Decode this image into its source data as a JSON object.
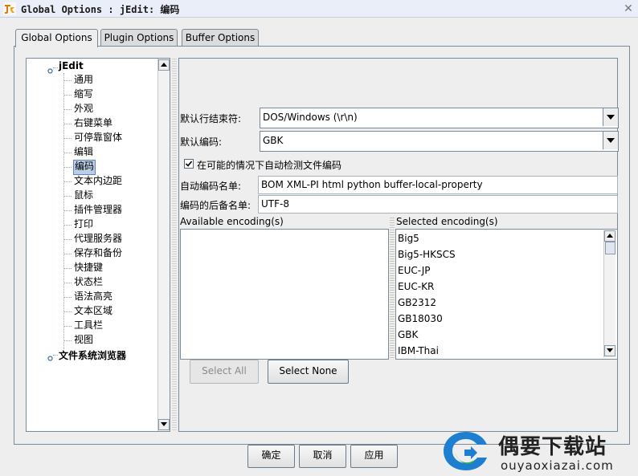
{
  "window": {
    "title": "Global Options : jEdit: 编码",
    "close_glyph": "✕"
  },
  "tabs": [
    {
      "label": "Global Options",
      "active": true
    },
    {
      "label": "Plugin Options",
      "active": false
    },
    {
      "label": "Buffer Options",
      "active": false
    }
  ],
  "tree": {
    "root_label": "jEdit",
    "items": [
      "通用",
      "缩写",
      "外观",
      "右键菜单",
      "可停靠窗体",
      "编辑",
      "编码",
      "文本内边距",
      "鼠标",
      "插件管理器",
      "打印",
      "代理服务器",
      "保存和备份",
      "快捷键",
      "状态栏",
      "语法高亮",
      "文本区域",
      "工具栏",
      "视图"
    ],
    "selected": "编码",
    "second_root_label": "文件系统浏览器"
  },
  "encoding_panel": {
    "line_sep_label": "默认行结束符:",
    "line_sep_value": "DOS/Windows (\\r\\n)",
    "encoding_label": "默认编码:",
    "encoding_value": "GBK",
    "auto_detect_label": "在可能的情况下自动检测文件编码",
    "auto_detect_checked": true,
    "auto_names_label": "自动编码名单:",
    "auto_names_value": "BOM XML-PI html python buffer-local-property",
    "fallback_label": "编码的后备名单:",
    "fallback_value": "UTF-8",
    "available_label": "Available encoding(s)",
    "selected_label": "Selected encoding(s)",
    "selected_encodings": [
      "Big5",
      "Big5-HKSCS",
      "EUC-JP",
      "EUC-KR",
      "GB2312",
      "GB18030",
      "GBK",
      "IBM-Thai"
    ],
    "select_all_label": "Select All",
    "select_none_label": "Select None"
  },
  "footer": {
    "ok_label": "确定",
    "cancel_label": "取消",
    "apply_label": "应用"
  },
  "watermark": {
    "name": "偶要下载站",
    "url": "ouyaoxiazai.com"
  },
  "colors": {
    "selection": "#b8cfe5",
    "border": "#7a8a99",
    "logo_blue": "#1e7fd0",
    "logo_green": "#2db34a"
  }
}
